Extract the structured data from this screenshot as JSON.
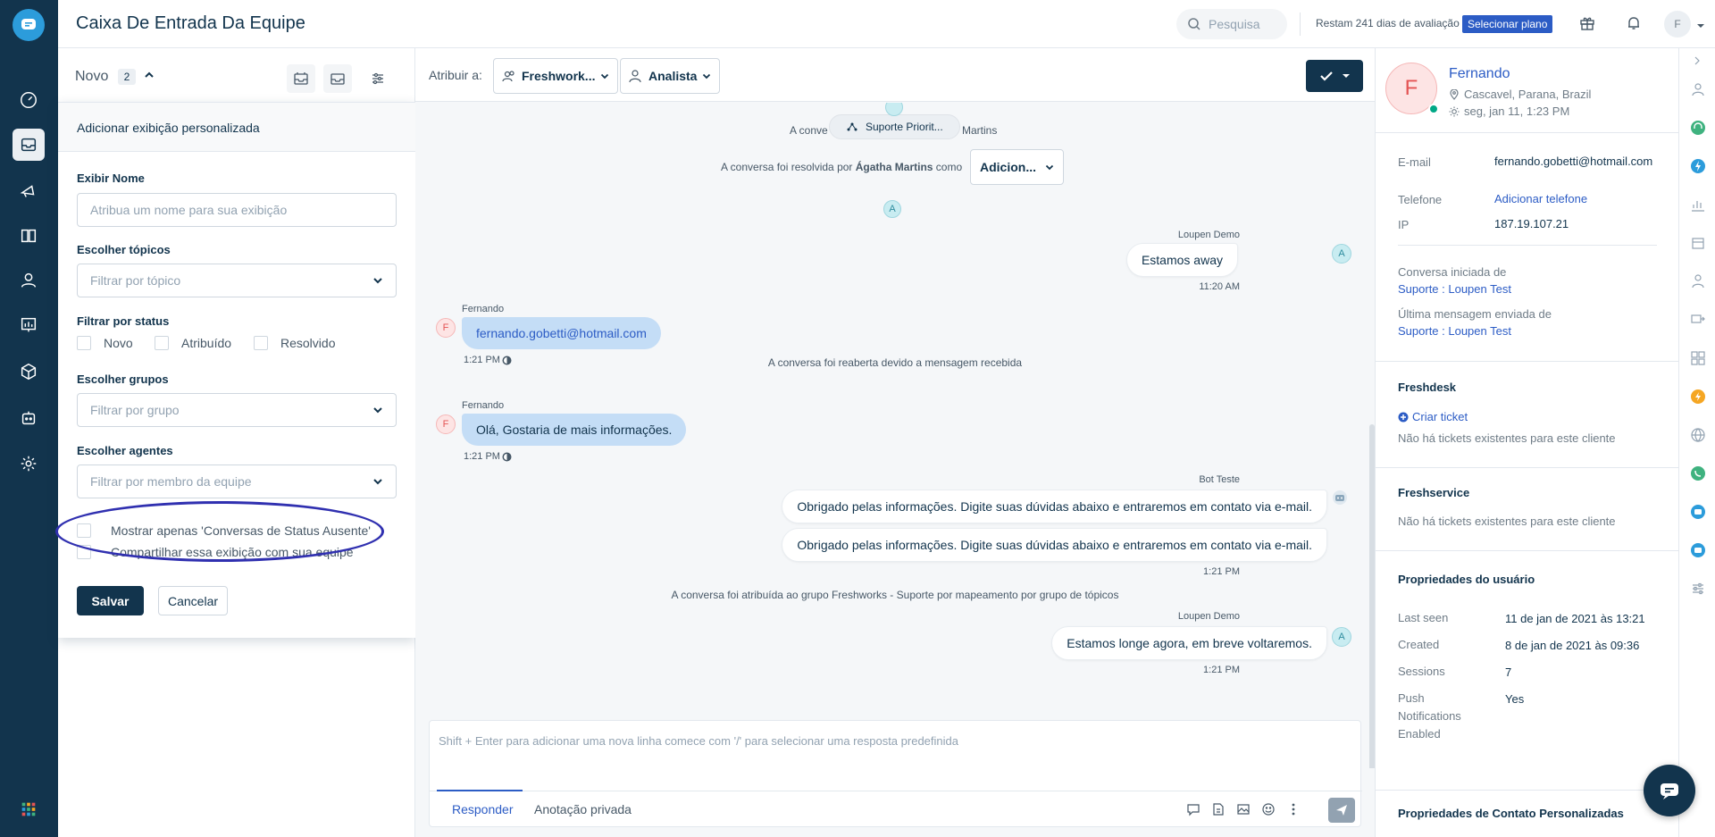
{
  "header": {
    "title": "Caixa De Entrada Da Equipe",
    "search_placeholder": "Pesquisa",
    "trial_text": "Restam 241 dias de avaliação",
    "plan_button": "Selecionar plano",
    "avatar_initial": "F"
  },
  "list": {
    "title": "Novo",
    "count": "2"
  },
  "custom_view": {
    "heading": "Adicionar exibição personalizada",
    "name_label": "Exibir Nome",
    "name_placeholder": "Atribua um nome para sua exibição",
    "topics_label": "Escolher tópicos",
    "topics_placeholder": "Filtrar por tópico",
    "status_label": "Filtrar por status",
    "status_options": [
      "Novo",
      "Atribuído",
      "Resolvido"
    ],
    "groups_label": "Escolher grupos",
    "groups_placeholder": "Filtrar por grupo",
    "agents_label": "Escolher agentes",
    "agents_placeholder": "Filtrar por membro da equipe",
    "away_only_label": "Mostrar apenas 'Conversas de Status Ausente'",
    "share_label": "Compartilhar essa exibição com sua equipe",
    "save_label": "Salvar",
    "cancel_label": "Cancelar"
  },
  "conversation": {
    "assign_label": "Atribuir a:",
    "group_dropdown": "Freshwork...",
    "agent_dropdown": "Analista",
    "topic_pill": "Suporte Priorit...",
    "sys_top_left": "A conve",
    "sys_top_right": "Martins",
    "resolved_prefix": "A conversa foi resolvida por",
    "resolved_agent": "Ágatha Martins",
    "resolved_suffix": "como",
    "resolved_dropdown": "Adicion...",
    "messages": [
      {
        "sender": "Loupen Demo",
        "text": "Estamos away",
        "time": "11:20 AM",
        "avatar": "A"
      },
      {
        "sender": "Fernando",
        "text": "fernando.gobetti@hotmail.com",
        "time": "1:21 PM",
        "avatar": "F"
      },
      {
        "sender": "Fernando",
        "text": "Olá, Gostaria de mais informações.",
        "time": "1:21 PM",
        "avatar": "F"
      },
      {
        "sender": "Bot Teste",
        "text": "Obrigado pelas informações. Digite suas dúvidas abaixo e entraremos em contato via e-mail.",
        "time": "",
        "avatar": ""
      },
      {
        "sender": "",
        "text": "Obrigado pelas informações. Digite suas dúvidas abaixo e entraremos em contato via e-mail.",
        "time": "1:21 PM",
        "avatar": ""
      },
      {
        "sender": "Loupen Demo",
        "text": "Estamos longe agora, em breve voltaremos.",
        "time": "1:21 PM",
        "avatar": "A"
      }
    ],
    "sys_reopened": "A conversa foi reaberta devido a mensagem recebida",
    "sys_assigned": "A conversa foi atribuída ao grupo Freshworks - Suporte por mapeamento por grupo de tópicos",
    "composer_placeholder": "Shift + Enter para adicionar uma nova linha comece com '/' para selecionar uma resposta predefinida",
    "tab_reply": "Responder",
    "tab_private": "Anotação privada"
  },
  "contact": {
    "initial": "F",
    "name": "Fernando",
    "location": "Cascavel, Parana, Brazil",
    "local_time": "seg, jan 11, 1:23 PM",
    "email_label": "E-mail",
    "email_value": "fernando.gobetti@hotmail.com",
    "phone_label": "Telefone",
    "phone_value": "Adicionar telefone",
    "ip_label": "IP",
    "ip_value": "187.19.107.21",
    "started_label": "Conversa iniciada de",
    "started_value": "Suporte : Loupen Test",
    "last_msg_label": "Última mensagem enviada de",
    "last_msg_value": "Suporte : Loupen Test",
    "freshdesk_title": "Freshdesk",
    "create_ticket": "Criar ticket",
    "freshdesk_empty": "Não há tickets existentes para este cliente",
    "freshservice_title": "Freshservice",
    "freshservice_empty": "Não há tickets existentes para este cliente",
    "user_props_title": "Propriedades do usuário",
    "props": [
      {
        "label": "Last seen",
        "value": "11 de jan de 2021 às 13:21"
      },
      {
        "label": "Created",
        "value": "8 de jan de 2021 às 09:36"
      },
      {
        "label": "Sessions",
        "value": "7"
      },
      {
        "label": "Push Notifications Enabled",
        "value": "Yes"
      }
    ],
    "custom_props_title": "Propriedades de Contato Personalizadas"
  },
  "colors": {
    "nav_bg": "#12344d",
    "accent": "#2c5cc5",
    "annotation_oval": "#3030b0"
  }
}
